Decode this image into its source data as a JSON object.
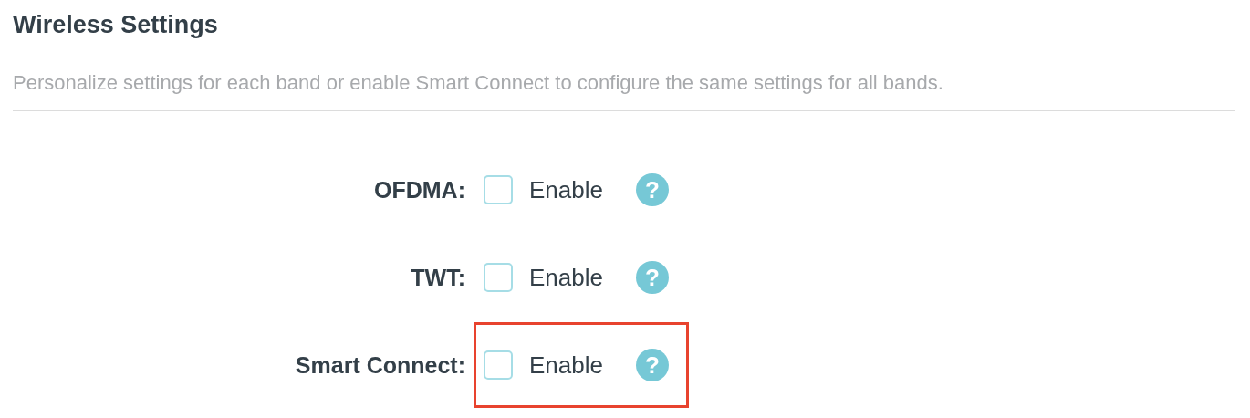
{
  "title": "Wireless Settings",
  "description": "Personalize settings for each band or enable Smart Connect to configure the same settings for all bands.",
  "settings": [
    {
      "label": "OFDMA:",
      "option": "Enable",
      "checked": false,
      "help": "?",
      "highlighted": false
    },
    {
      "label": "TWT:",
      "option": "Enable",
      "checked": false,
      "help": "?",
      "highlighted": false
    },
    {
      "label": "Smart Connect:",
      "option": "Enable",
      "checked": false,
      "help": "?",
      "highlighted": true
    }
  ]
}
